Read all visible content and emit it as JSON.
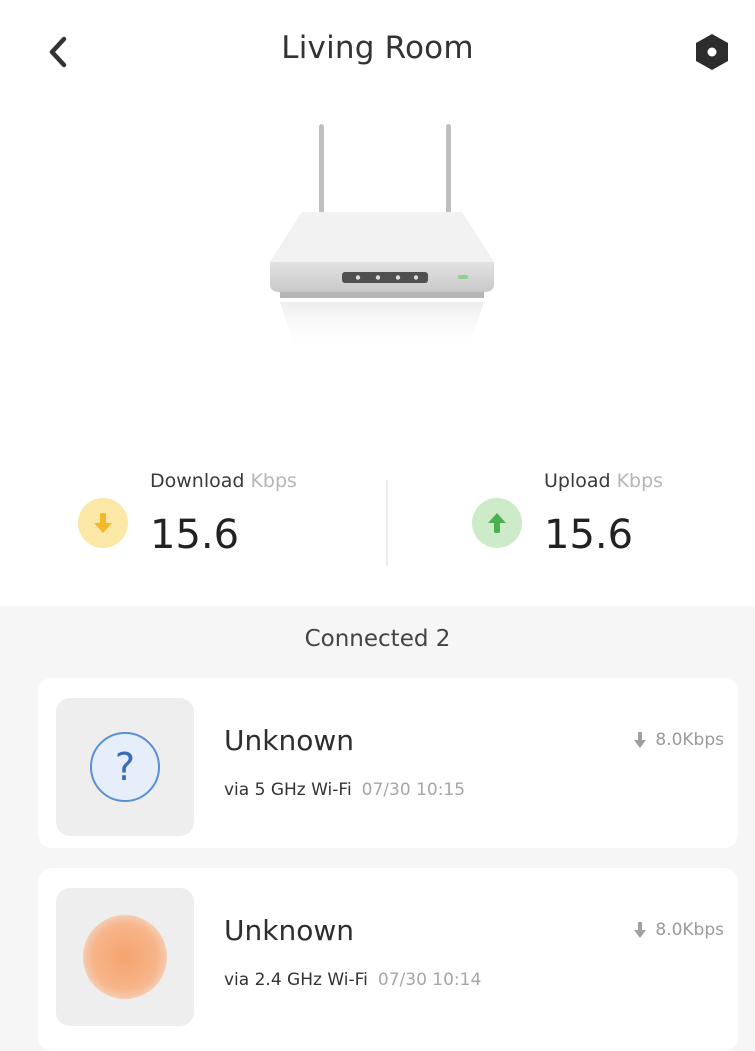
{
  "header": {
    "title": "Living Room",
    "back_icon": "chevron-left-icon",
    "settings_icon": "hex-gear-icon"
  },
  "router": {
    "image": "router-icon"
  },
  "stats": {
    "download": {
      "label": "Download",
      "unit": "Kbps",
      "value": "15.6",
      "icon": "arrow-down-icon",
      "color": "#f2b827"
    },
    "upload": {
      "label": "Upload",
      "unit": "Kbps",
      "value": "15.6",
      "icon": "arrow-up-icon",
      "color": "#4caf50"
    }
  },
  "connected": {
    "title": "Connected 2",
    "devices": [
      {
        "name": "Unknown",
        "via": "via 5 GHz Wi-Fi",
        "time": "07/30 10:15",
        "rate": "8.0Kbps",
        "avatar": "question-icon"
      },
      {
        "name": "Unknown",
        "via": "via 2.4 GHz Wi-Fi",
        "time": "07/30 10:14",
        "rate": "8.0Kbps",
        "avatar": "orange-avatar"
      }
    ]
  },
  "colors": {
    "background": "#ffffff",
    "section_bg": "#f6f6f6",
    "question_blue": "#3a6cb8",
    "avatar_orange": "#f4a46d"
  }
}
